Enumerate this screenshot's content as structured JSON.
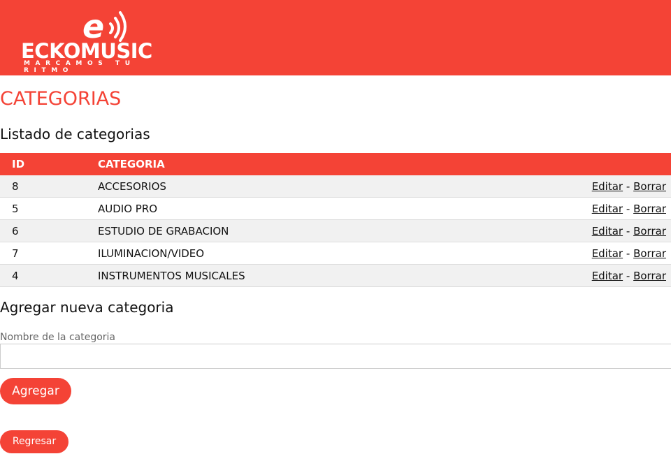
{
  "brand": {
    "name": "ECKOMUSIC",
    "tagline": "MARCAMOS TU RITMO",
    "logo_icon": "e-sound-waves-icon",
    "accent_color": "#f44336"
  },
  "page": {
    "title": "CATEGORIAS",
    "list_title": "Listado de categorias",
    "add_title": "Agregar nueva categoria"
  },
  "table": {
    "columns": [
      "ID",
      "CATEGORIA"
    ],
    "rows": [
      {
        "id": "8",
        "name": "ACCESORIOS"
      },
      {
        "id": "5",
        "name": "AUDIO PRO"
      },
      {
        "id": "6",
        "name": "ESTUDIO DE GRABACION"
      },
      {
        "id": "7",
        "name": "ILUMINACION/VIDEO"
      },
      {
        "id": "4",
        "name": "INSTRUMENTOS MUSICALES"
      }
    ],
    "edit_label": "Editar",
    "separator": "-",
    "delete_label": "Borrar"
  },
  "form": {
    "label": "Nombre de la categoria",
    "value": "",
    "placeholder": "",
    "submit_label": "Agregar"
  },
  "footer": {
    "back_label": "Regresar"
  }
}
